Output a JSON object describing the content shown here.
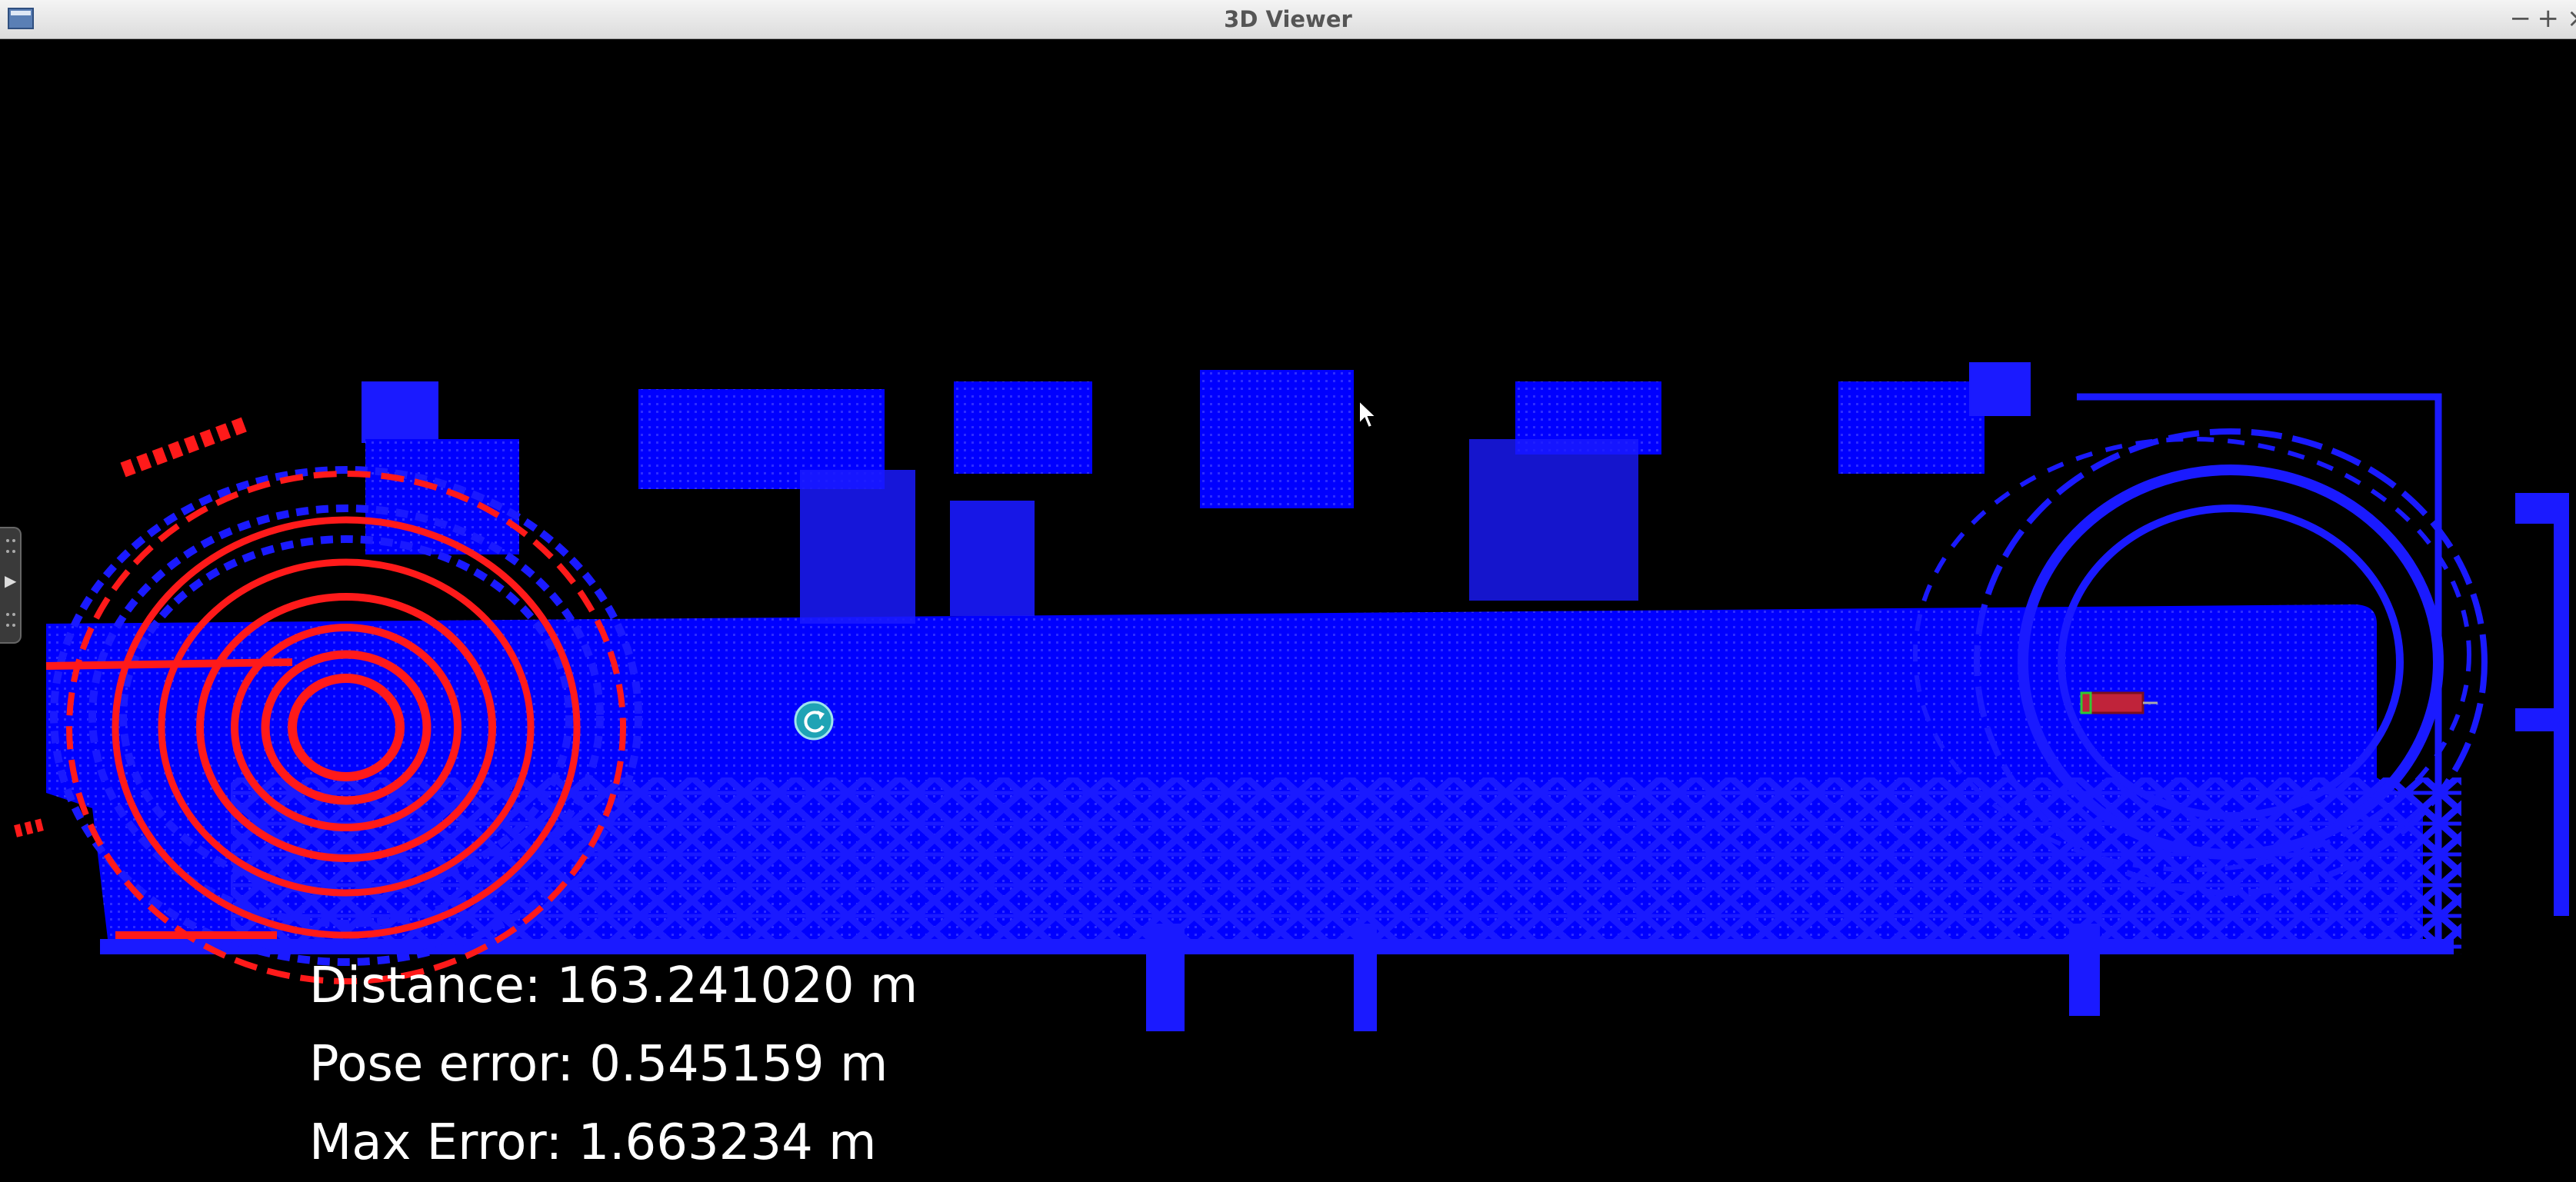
{
  "window": {
    "title": "3D Viewer",
    "minimize_label": "−",
    "maximize_label": "+",
    "close_label": "×"
  },
  "overlay": {
    "distance": "Distance: 163.241020 m",
    "pose_error": "Pose error: 0.545159 m",
    "max_error": "Max Error: 1.663234 m"
  },
  "colors": {
    "background": "#000000",
    "map_cloud": "#1a1aff",
    "scan_cloud": "#ff1a1a",
    "marker": "#1fa3b5"
  },
  "icons": {
    "reset_marker": "reset-icon",
    "panel_toggle": "panel-toggle-icon",
    "cursor": "mouse-pointer-icon",
    "vehicle": "vehicle-box-icon"
  }
}
